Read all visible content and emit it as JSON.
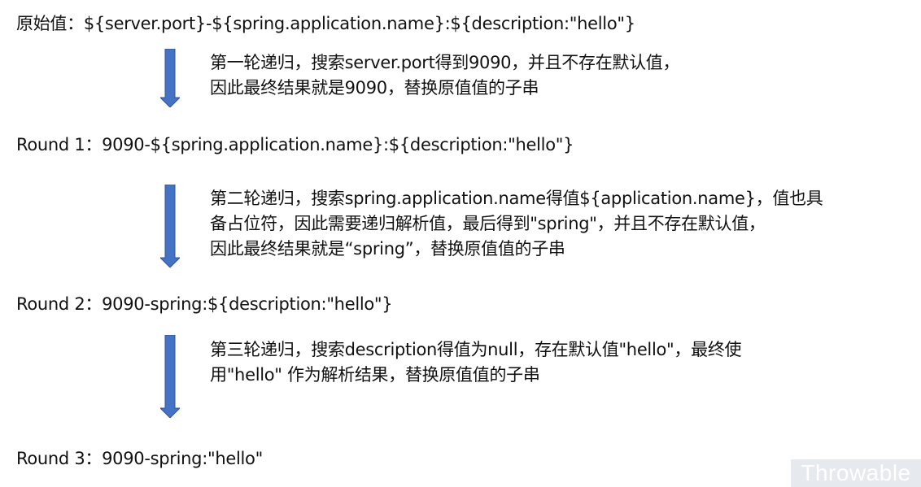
{
  "original": {
    "label": "原始值：",
    "value": "${server.port}-${spring.application.name}:${description:\"hello\"}"
  },
  "steps": [
    {
      "lines": [
        "第一轮递归，搜索server.port得到9090，并且不存在默认值，",
        "因此最终结果就是9090，替换原值值的子串"
      ]
    },
    {
      "lines": [
        "第二轮递归，搜索spring.application.name得值${application.name}，值也具",
        "备占位符，因此需要递归解析值，最后得到\"spring\"，并且不存在默认值，",
        "因此最终结果就是“spring”，替换原值值的子串"
      ]
    },
    {
      "lines": [
        "第三轮递归，搜索description得值为null，存在默认值\"hello\"，最终使",
        "用\"hello\" 作为解析结果，替换原值值的子串"
      ]
    }
  ],
  "rounds": [
    {
      "label": "Round 1：",
      "value": "9090-${spring.application.name}:${description:\"hello\"}"
    },
    {
      "label": "Round 2：",
      "value": "9090-spring:${description:\"hello\"}"
    },
    {
      "label": "Round 3：",
      "value": "9090-spring:\"hello\""
    }
  ],
  "colors": {
    "arrow": "#4472c4",
    "arrow_edge": "#2f5597",
    "watermark_bg": "#e6e9ee"
  },
  "watermark": "Throwable"
}
